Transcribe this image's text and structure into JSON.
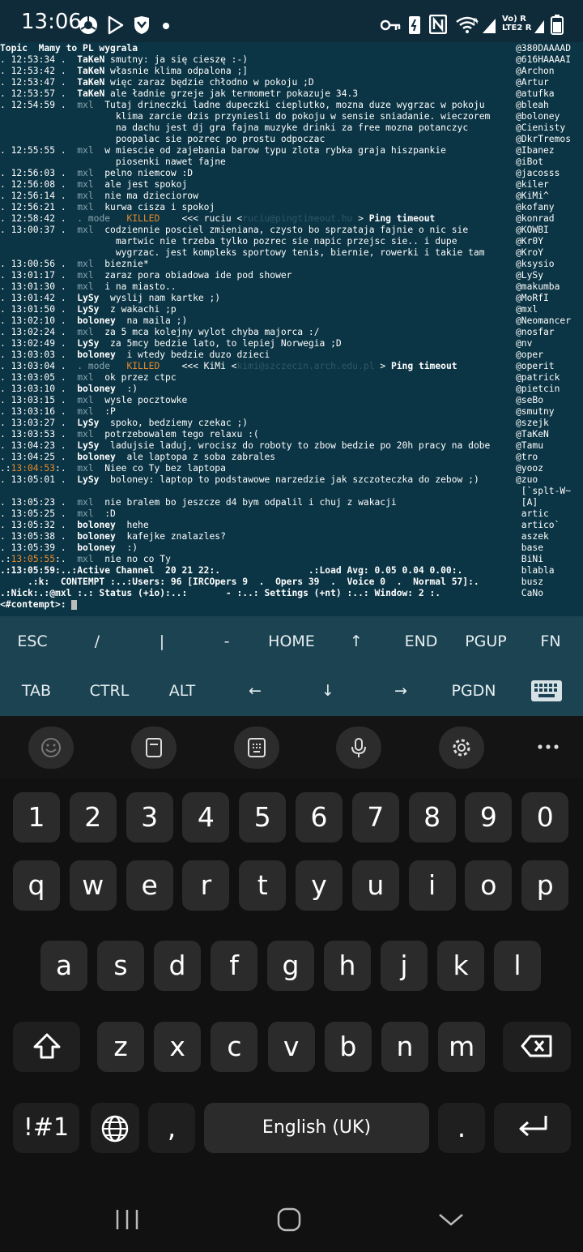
{
  "status_bar": {
    "time": "13:06",
    "icons": [
      "chrome-icon",
      "play-store-icon",
      "shield-icon",
      "dot-icon",
      "key-icon",
      "nfc-icon",
      "wifi-icon",
      "signal-icon",
      "battery-icon"
    ],
    "network_label": "Vo) R\nLTE2 R"
  },
  "terminal": {
    "topic": "Topic  Mamy to PL wygrala",
    "lines": [
      {
        "ts": ". 12:53:34 .",
        "nick": "TaKeN",
        "bold": true,
        "msg": " smutny: ja się cieszę :-)"
      },
      {
        "ts": ". 12:53:42 .",
        "nick": "TaKeN",
        "bold": true,
        "msg": " własnie klima odpalona ;]"
      },
      {
        "ts": ". 12:53:47 .",
        "nick": "TaKeN",
        "bold": true,
        "msg": " więc zaraz będzie chłodno w pokoju ;D"
      },
      {
        "ts": ". 12:53:57 .",
        "nick": "TaKeN",
        "bold": true,
        "msg": " ale ładnie grzeje jak termometr pokazuje 34.3"
      },
      {
        "ts": ". 12:54:59 .",
        "nick": "mxl",
        "bold": false,
        "msg": "  Tutaj drineczki ladne dupeczki cieplutko, mozna duze wygrzac w pokoju"
      },
      {
        "ts": "",
        "nick": "",
        "bold": false,
        "msg": "  klima zarcie dzis przyniesli do pokoju w sensie sniadanie. wieczorem"
      },
      {
        "ts": "",
        "nick": "",
        "bold": false,
        "msg": "  na dachu jest dj gra fajna muzyke drinki za free mozna potanczyc"
      },
      {
        "ts": "",
        "nick": "",
        "bold": false,
        "msg": "  poopalac sie pozrec po prostu odpoczac"
      },
      {
        "ts": ". 12:55:55 .",
        "nick": "mxl",
        "bold": false,
        "msg": "  w miescie od zajebania barow typu zlota rybka graja hiszpankie"
      },
      {
        "ts": "",
        "nick": "",
        "bold": false,
        "msg": "  piosenki nawet fajne"
      },
      {
        "ts": ". 12:56:03 .",
        "nick": "mxl",
        "bold": false,
        "msg": "  pelno niemcow :D"
      },
      {
        "ts": ". 12:56:08 .",
        "nick": "mxl",
        "bold": false,
        "msg": "  ale jest spokoj"
      },
      {
        "ts": ". 12:56:14 .",
        "nick": "mxl",
        "bold": false,
        "msg": "  nie ma dzieciorow"
      },
      {
        "ts": ". 12:56:21 .",
        "nick": "mxl",
        "bold": false,
        "msg": "  kurwa cisza i spokoj"
      },
      {
        "ts": ". 12:58:42 .",
        "nick": ". mode",
        "bold": false,
        "kill": true,
        "msg": "   KILLED    <<< ruciu <",
        "tail_dim": "ruciu@pingtimeout.hu",
        "tail": " > ",
        "tail_bold": "Ping timeout"
      },
      {
        "ts": ". 13:00:37 .",
        "nick": "mxl",
        "bold": false,
        "msg": "  codziennie posciel zmieniana, czysto bo sprzataja fajnie o nic sie"
      },
      {
        "ts": "",
        "nick": "",
        "bold": false,
        "msg": "  martwic nie trzeba tylko pozrec sie napic przejsc sie.. i dupe"
      },
      {
        "ts": "",
        "nick": "",
        "bold": false,
        "msg": "  wygrzac. jest kompleks sportowy tenis, biernie, rowerki i takie tam"
      },
      {
        "ts": ". 13:00:56 .",
        "nick": "mxl",
        "bold": false,
        "msg": "  bieznie*"
      },
      {
        "ts": ". 13:01:17 .",
        "nick": "mxl",
        "bold": false,
        "msg": "  zaraz pora obiadowa ide pod shower"
      },
      {
        "ts": ". 13:01:30 .",
        "nick": "mxl",
        "bold": false,
        "msg": "  i na miasto.."
      },
      {
        "ts": ". 13:01:42 .",
        "nick": "LySy",
        "bold": true,
        "msg": "  wyslij nam kartke ;)"
      },
      {
        "ts": ". 13:01:50 .",
        "nick": "LySy",
        "bold": true,
        "msg": "  z wakachi ;p"
      },
      {
        "ts": ". 13:02:10 .",
        "nick": "boloney",
        "bold": true,
        "msg": "  na maila ;)"
      },
      {
        "ts": ". 13:02:24 .",
        "nick": "mxl",
        "bold": false,
        "msg": "  za 5 mca kolejny wylot chyba majorca :/"
      },
      {
        "ts": ". 13:02:49 .",
        "nick": "LySy",
        "bold": true,
        "msg": "  za 5mcy bedzie lato, to lepiej Norwegia ;D"
      },
      {
        "ts": ". 13:03:03 .",
        "nick": "boloney",
        "bold": true,
        "msg": "  i wtedy bedzie duzo dzieci"
      },
      {
        "ts": ". 13:03:04 .",
        "nick": ". mode",
        "bold": false,
        "kill": true,
        "msg": "   KILLED    <<< KiMi <",
        "tail_dim": "kimi@szczecin.arch.edu.pl",
        "tail": " > ",
        "tail_bold": "Ping timeout"
      },
      {
        "ts": ". 13:03:05 .",
        "nick": "mxl",
        "bold": false,
        "msg": "  ok przez ctpc"
      },
      {
        "ts": ". 13:03:10 .",
        "nick": "boloney",
        "bold": true,
        "msg": "  :)"
      },
      {
        "ts": ". 13:03:15 .",
        "nick": "mxl",
        "bold": false,
        "msg": "  wysle pocztowke"
      },
      {
        "ts": ". 13:03:16 .",
        "nick": "mxl",
        "bold": false,
        "msg": "  :P"
      },
      {
        "ts": ". 13:03:27 .",
        "nick": "LySy",
        "bold": true,
        "msg": "  spoko, bedziemy czekac ;)"
      },
      {
        "ts": ". 13:03:53 .",
        "nick": "mxl",
        "bold": false,
        "msg": "  potrzebowalem tego relaxu :("
      },
      {
        "ts": ". 13:04:23 .",
        "nick": "LySy",
        "bold": true,
        "msg": "  ladujsie laduj, wrocisz do roboty to zbow bedzie po 20h pracy na dobe"
      },
      {
        "ts": ". 13:04:25 .",
        "nick": "boloney",
        "bold": true,
        "msg": "  ale laptopa z soba zabrales"
      },
      {
        "ts": ".:13:04:53:.",
        "nick": "mxl",
        "bold": false,
        "hl": true,
        "msg": "  Niee co Ty bez laptopa"
      },
      {
        "ts": ". 13:05:01 .",
        "nick": "LySy",
        "bold": true,
        "msg": "  boloney: laptop to podstawowe narzedzie jak szczoteczka do zebow ;)"
      },
      {
        "ts": "",
        "nick": "",
        "bold": false,
        "msg": ""
      },
      {
        "ts": ". 13:05:23 .",
        "nick": "mxl",
        "bold": false,
        "msg": "  nie bralem bo jeszcze d4 bym odpalil i chuj z wakacji"
      },
      {
        "ts": ". 13:05:25 .",
        "nick": "mxl",
        "bold": false,
        "msg": "  :D"
      },
      {
        "ts": ". 13:05:32 .",
        "nick": "boloney",
        "bold": true,
        "msg": "  hehe"
      },
      {
        "ts": ". 13:05:38 .",
        "nick": "boloney",
        "bold": true,
        "msg": "  kafejke znalazles?"
      },
      {
        "ts": ". 13:05:39 .",
        "nick": "boloney",
        "bold": true,
        "msg": "  :)"
      },
      {
        "ts": ".:13:05:55:.",
        "nick": "mxl",
        "bold": false,
        "hl": true,
        "msg": "  nie no co Ty"
      }
    ],
    "status_line1": ".:13:05:59:..:Active Channel  20 21 22:.                .:Load Avg: 0.05 0.04 0.00:.",
    "status_line2": "     .:k:  CONTEMPT :..:Users: 96 [IRCOpers 9  .  Opers 39  .  Voice 0  .  Normal 57]:.",
    "status_line3": ".:Nick:.:@mxl :.: Status (+io):..:       - :..: Settings (+nt) :..: Window: 2 :.",
    "prompt": "<#contempt>:",
    "nicklist": [
      "@380DAAAAD",
      "@616HAAAAI",
      "@Archon",
      "@Artur",
      "@atufka",
      "@bleah",
      "@boloney",
      "@Cienisty",
      "@DkrTremos",
      "@Ibanez",
      "@iBot",
      "@jacosss",
      "@kiler",
      "@KiMi^",
      "@kofany",
      "@konrad",
      "@KOWBI",
      "@Kr0Y",
      "@KroY",
      "@ksysio",
      "@LySy",
      "@makumba",
      "@MoRfI",
      "@mxl",
      "@Neomancer",
      "@nosfar",
      "@nv",
      "@oper",
      "@operit",
      "@patrick",
      "@pietcin",
      "@seBo",
      "@smutny",
      "@szejk",
      "@TaKeN",
      "@Tamu",
      "@tro",
      "@yooz",
      "@zuo",
      " [`splt-W~",
      " [A]",
      " artic",
      " artico`",
      " aszek",
      " base",
      " BiNi",
      " blabla",
      " busz",
      " CaNo"
    ]
  },
  "extra_keys": {
    "row1": [
      "ESC",
      "/",
      "|",
      "-",
      "HOME",
      "↑",
      "END",
      "PGUP",
      "FN"
    ],
    "row2": [
      "TAB",
      "CTRL",
      "ALT",
      "←",
      "↓",
      "→",
      "PGDN",
      ""
    ]
  },
  "keyboard": {
    "toolbar": [
      "emoji-icon",
      "clipboard-icon",
      "keypad-icon",
      "mic-icon",
      "settings-icon",
      "more-icon"
    ],
    "row_numbers": [
      "1",
      "2",
      "3",
      "4",
      "5",
      "6",
      "7",
      "8",
      "9",
      "0"
    ],
    "row_q": [
      "q",
      "w",
      "e",
      "r",
      "t",
      "y",
      "u",
      "i",
      "o",
      "p"
    ],
    "row_a": [
      "a",
      "s",
      "d",
      "f",
      "g",
      "h",
      "j",
      "k",
      "l"
    ],
    "row_z": [
      "z",
      "x",
      "c",
      "v",
      "b",
      "n",
      "m"
    ],
    "symbols_label": "!#1",
    "comma": ",",
    "space_label": "English (UK)",
    "period": "."
  }
}
